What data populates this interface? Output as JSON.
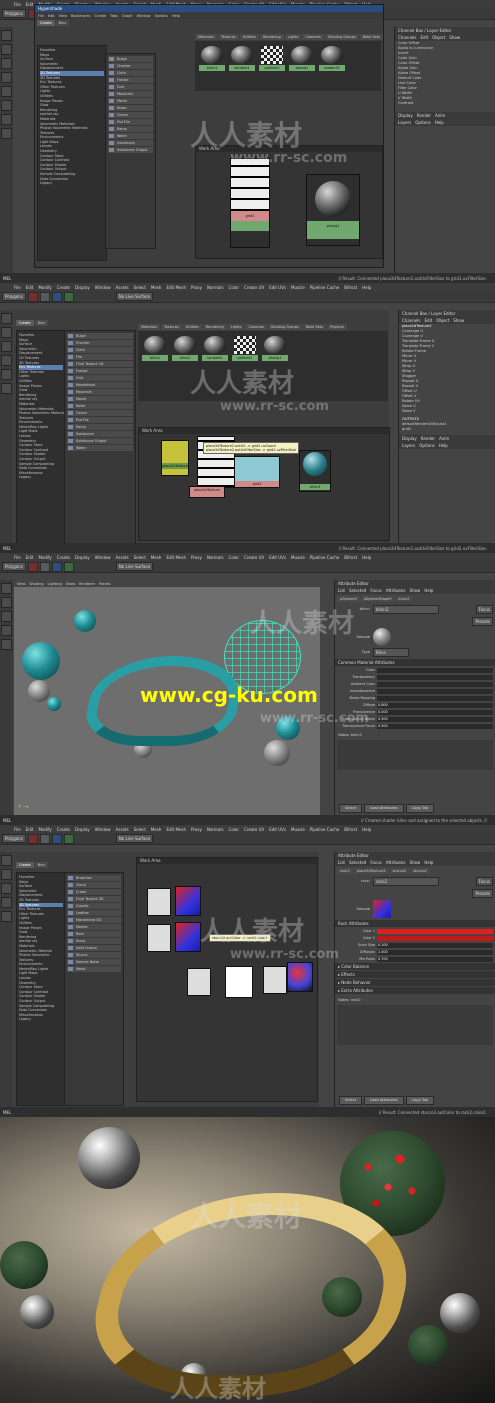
{
  "watermarks": {
    "cn": "人人素材",
    "url": "www.rr-sc.com",
    "cgku": "www.cg-ku.com"
  },
  "maya_menus": [
    "File",
    "Edit",
    "Modify",
    "Create",
    "Display",
    "Window",
    "Assets",
    "Select",
    "Mesh",
    "Edit Mesh",
    "Proxy",
    "Normals",
    "Color",
    "Create UV",
    "Edit UVs",
    "Muscle",
    "Pipeline Cache",
    "Bifrost",
    "Help"
  ],
  "shelf_tabs": [
    "General",
    "Curves",
    "Surfaces",
    "Polygons",
    "Subdiv",
    "Deformation",
    "Animation",
    "Dynamics",
    "Rendering",
    "PaintEffects",
    "Toon",
    "Muscle",
    "Fluids",
    "Fur"
  ],
  "toolbar": {
    "mode": "Polygons",
    "live": "No Live Surface"
  },
  "panel1": {
    "title": "Hypershade",
    "menu": [
      "File",
      "Edit",
      "View",
      "Bookmarks",
      "Create",
      "Tabs",
      "Graph",
      "Window",
      "Options",
      "Help"
    ],
    "left_tabs": [
      "Create",
      "Bins"
    ],
    "tree": [
      "Favorites",
      "Maya",
      "Surface",
      "Volumetric",
      "Displacement",
      "2D Textures",
      "3D Textures",
      "Env Textures",
      "Other Textures",
      "Lights",
      "Utilities",
      "Image Planes",
      "Glow",
      "Rendering",
      "mental ray",
      "Materials",
      "Volumetric Materials",
      "Photon Volumetric Materials",
      "Textures",
      "Environments",
      "Light Maps",
      "Lenses",
      "Geometry",
      "Contour Store",
      "Contour Contrast",
      "Contour Shader",
      "Contour Output",
      "Sample Compositing",
      "Data Conversion",
      "Legacy"
    ],
    "nodes": [
      "Bulge",
      "Checker",
      "Cloth",
      "Fractal",
      "Grid",
      "Mountain",
      "Movie",
      "Noise",
      "Ocean",
      "Psd File",
      "Ramp",
      "Water",
      "Substance",
      "Substance Output"
    ],
    "tabs": [
      "Materials",
      "Textures",
      "Utilities",
      "Rendering",
      "Lights",
      "Cameras",
      "Shading Groups",
      "Bake Sets"
    ],
    "swatches": [
      "blinn1",
      "lambert1",
      "particle1",
      "phong1",
      "shader01"
    ],
    "work_area": "Work Area",
    "work_nodes": [
      "grid1",
      "phong1"
    ],
    "result": "// Result: Connected place2dTexture1.outUvFilterSize to grid1.uvFilterSize.",
    "attr_header": [
      "Display",
      "Show",
      "Help"
    ],
    "attr_lines": [
      "Color Offset",
      "Alpha Is Luminance",
      "Invert",
      "Color Gain",
      "Color Offset",
      "Alpha Gain",
      "Alpha Offset",
      "Default Color",
      "Line Color",
      "Filler Color",
      "U Width",
      "V Width",
      "Contrast"
    ],
    "channel_title": "Channel Box / Layer Editor",
    "channel_menu": [
      "Channels",
      "Edit",
      "Object",
      "Show"
    ],
    "layer_menu": [
      "Display",
      "Render",
      "Anim"
    ],
    "layer_sub": [
      "Layers",
      "Options",
      "Help"
    ]
  },
  "panel2": {
    "status": "Hypergraph: Select a node.",
    "tabs": [
      "Create",
      "Bins"
    ],
    "tree": [
      "Favorites",
      "Maya",
      "Surface",
      "Volumetric",
      "Displacement",
      "2D Textures",
      "3D Textures",
      "Env Textures",
      "Other Textures",
      "Lights",
      "Utilities",
      "Image Planes",
      "Glow",
      "Rendering",
      "mental ray",
      "Materials",
      "Volumetric Materials",
      "Photon Volumetric Materials",
      "Textures",
      "Environments",
      "MentalRay Lights",
      "Light Maps",
      "Lenses",
      "Geometry",
      "Contour Store",
      "Contour Contrast",
      "Contour Shader",
      "Contour Output",
      "Sample Compositing",
      "Data Conversion",
      "Miscellaneous",
      "Legacy"
    ],
    "nodes": [
      "Bulge",
      "Checker",
      "Cloth",
      "File",
      "Fluid Texture 2D",
      "Fractal",
      "Grid",
      "Mandelbrot",
      "Mountain",
      "Movie",
      "Noise",
      "Ocean",
      "Psd File",
      "Ramp",
      "Substance",
      "Substance Output",
      "Water"
    ],
    "mat_tabs": [
      "Materials",
      "Textures",
      "Utilities",
      "Rendering",
      "Lights",
      "Cameras",
      "Shading Groups",
      "Bake Sets",
      "Projects"
    ],
    "swatches": [
      "blinn1",
      "blinn2",
      "lambert1",
      "particle1",
      "phong1"
    ],
    "work_area": "Work Area",
    "tooltip": [
      "place2dTexture2.outUV -> grid2.uvCoord",
      "place2dTexture2.outUvFilterSize -> grid2.uvFilterSize"
    ],
    "work_nodes": [
      "place2dTexture2",
      "place2dTexture",
      "grid2",
      "blinn3"
    ],
    "channel_node": "place2dTexture2",
    "channels": [
      "Coverage U",
      "Coverage V",
      "Translate Frame U",
      "Translate Frame V",
      "Rotate Frame",
      "Mirror U",
      "Mirror V",
      "Wrap U",
      "Wrap V",
      "Stagger",
      "Repeat U",
      "Repeat V",
      "Offset U",
      "Offset V",
      "Rotate UV",
      "Noise U",
      "Noise V"
    ],
    "outputs": "OUTPUTS",
    "out_items": [
      "defaultRenderUtilityList1",
      "grid2"
    ],
    "result": "// Result: Connected place2dTexture1.outUvFilterSize to grid2.uvFilterSize."
  },
  "panel3": {
    "status": "Hypergraph: Select a node.",
    "view_menu": [
      "View",
      "Shading",
      "Lighting",
      "Show",
      "Renderer",
      "Panels"
    ],
    "attr_title": "Attribute Editor",
    "attr_menu": [
      "List",
      "Selected",
      "Focus",
      "Attributes",
      "Show",
      "Help"
    ],
    "attr_tabs": [
      "pSphere9",
      "pSphereShape9",
      "blinn2"
    ],
    "blinn_label": "blinn:",
    "blinn_name": "blinn2",
    "focus": "Focus",
    "presets": "Presets",
    "sample": "Sample",
    "type_label": "Type",
    "type_value": "Blinn",
    "section": "Common Material Attributes",
    "attrs": [
      {
        "k": "Color",
        "v": ""
      },
      {
        "k": "Transparency",
        "v": ""
      },
      {
        "k": "Ambient Color",
        "v": ""
      },
      {
        "k": "Incandescence",
        "v": ""
      },
      {
        "k": "Bump Mapping",
        "v": ""
      },
      {
        "k": "Diffuse",
        "v": "0.800"
      },
      {
        "k": "Translucence",
        "v": "0.000"
      },
      {
        "k": "Translucence Depth",
        "v": "0.500"
      },
      {
        "k": "Translucence Focus",
        "v": "0.500"
      }
    ],
    "notes": "Notes: blinn2",
    "buttons": [
      "Select",
      "Load Attributes",
      "Copy Tab"
    ],
    "result": "// Created shader blinn and assigned to the selected objects. //"
  },
  "panel4": {
    "status": "Hypershade: Select an object",
    "tree": [
      "Favorites",
      "Maya",
      "Surface",
      "Volumetric",
      "Displacement",
      "2D Textures",
      "3D Textures",
      "Env Textures",
      "Other Textures",
      "Lights",
      "Utilities",
      "Image Planes",
      "Glow",
      "Rendering",
      "mental ray",
      "Materials",
      "Volumetric Material",
      "Photon Volumetric",
      "Textures",
      "Environments",
      "MentalRay Lights",
      "Light Maps",
      "Lenses",
      "Geometry",
      "Contour Store",
      "Contour Contrast",
      "Contour Shader",
      "Contour Output",
      "Sample Compositing",
      "Data Conversion",
      "Miscellaneous",
      "Legacy"
    ],
    "nodes": [
      "Brownian",
      "Cloud",
      "Crater",
      "Fluid Texture 3D",
      "Granite",
      "Leather",
      "Mandelbrot 3D",
      "Marble",
      "Rock",
      "Snow",
      "Solid Fractal",
      "Stucco",
      "Volume Noise",
      "Wood"
    ],
    "work_area": "Work Area",
    "tooltip": "stucco2.outColor -> rock2.color1",
    "attr_tabs": [
      "rock2",
      "place3dTexture2",
      "stucco2",
      "stucco2"
    ],
    "rock_label": "rock:",
    "rock_name": "rock2",
    "section": "Rock Attributes",
    "attrs": [
      {
        "k": "Color 1",
        "v": ""
      },
      {
        "k": "Color 2",
        "v": ""
      },
      {
        "k": "Grain Size",
        "v": "0.100"
      },
      {
        "k": "Diffusion",
        "v": "1.000"
      },
      {
        "k": "Mix Ratio",
        "v": "0.700"
      }
    ],
    "sections": [
      "Color Balance",
      "Effects",
      "Node Behavior",
      "Extra Attributes"
    ],
    "notes": "Notes: rock2",
    "buttons": [
      "Select",
      "Load Attributes",
      "Copy Tab"
    ],
    "result": "// Result: Connected stucco2.outColor to rock2.color2."
  },
  "colors": {
    "teal": "#1f8f95",
    "accent": "#2b4c7e",
    "swatch_green": "#70a870"
  }
}
